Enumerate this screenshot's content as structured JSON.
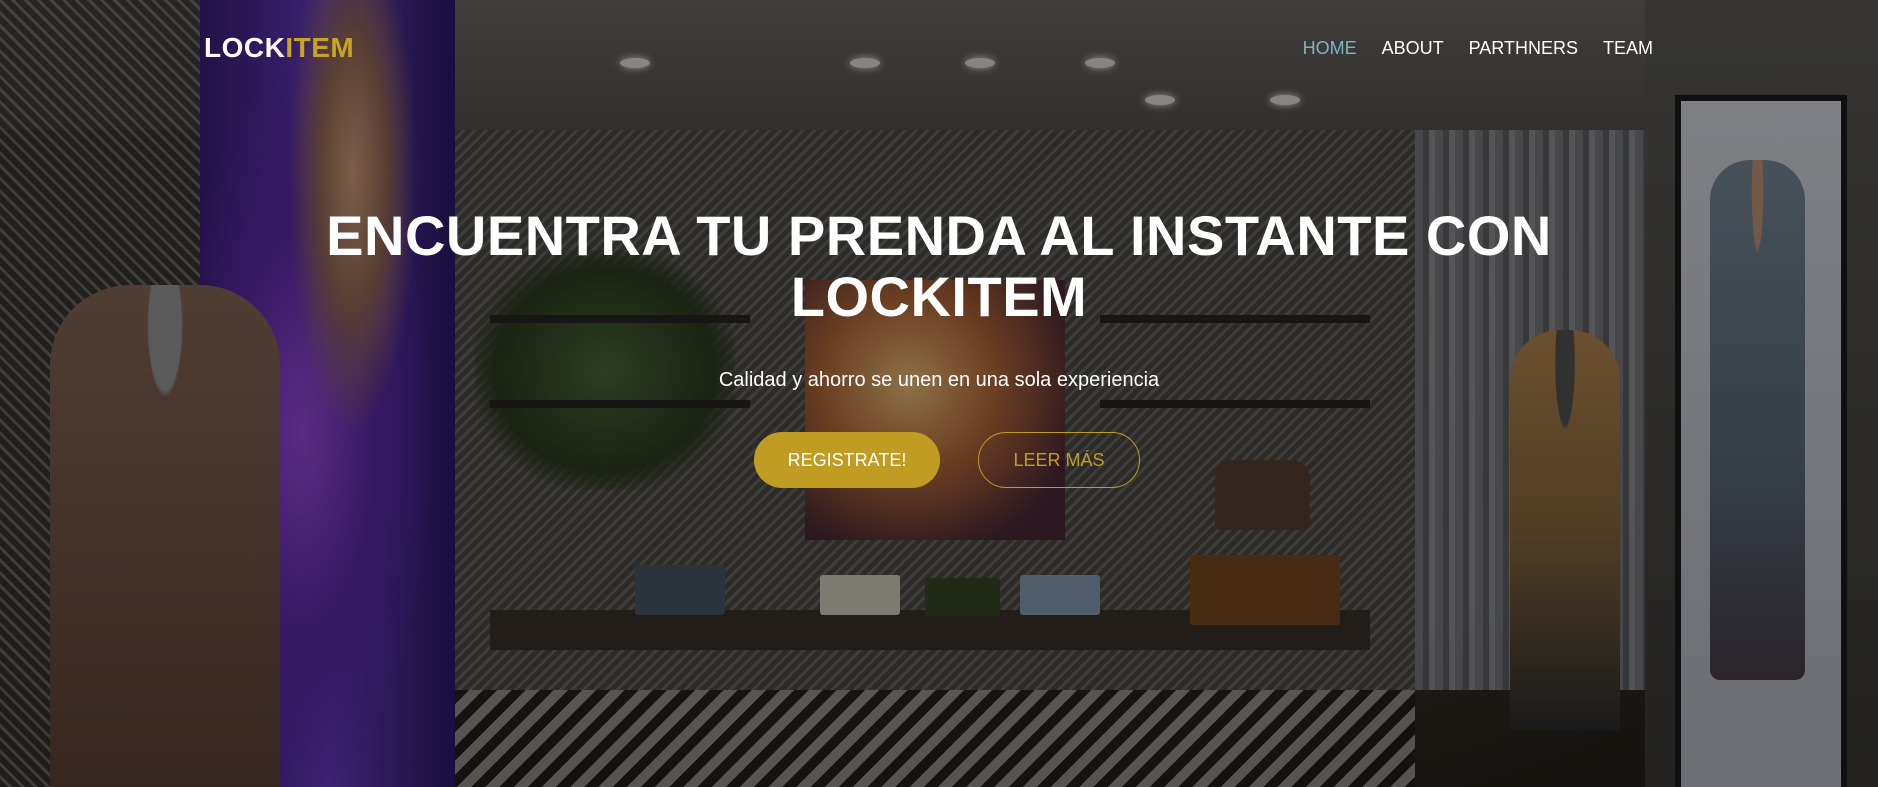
{
  "brand": {
    "logo_part1": "LOCK",
    "logo_part2": "ITEM",
    "accent_color": "#c09d22"
  },
  "nav": {
    "items": [
      {
        "label": "HOME",
        "active": true
      },
      {
        "label": "ABOUT",
        "active": false
      },
      {
        "label": "PARTHNERS",
        "active": false
      },
      {
        "label": "TEAM",
        "active": false
      }
    ],
    "active_color": "#7fb5c0"
  },
  "hero": {
    "title": "ENCUENTRA TU PRENDA AL INSTANTE CON LOCKITEM",
    "subtitle": "Calidad y ahorro se unen en una sola experiencia",
    "primary_button": "REGISTRATE!",
    "secondary_button": "LEER MÁS"
  }
}
